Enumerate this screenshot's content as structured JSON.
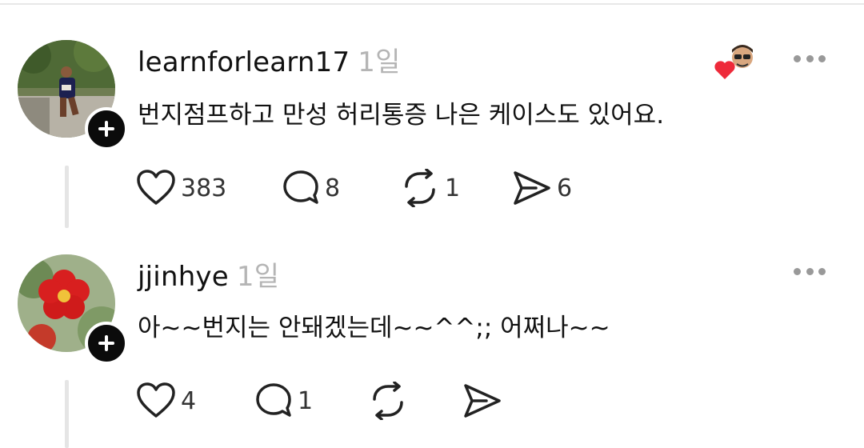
{
  "posts": [
    {
      "username": "learnforlearn17",
      "time": "1일",
      "text": "번지점프하고 만성 허리통증 나은 케이스도 있어요.",
      "counts": {
        "likes": "383",
        "replies": "8",
        "reposts": "1",
        "shares": "6"
      },
      "avatar_icon": "runner-photo"
    },
    {
      "username": "jjinhye",
      "time": "1일",
      "text": "아~~번지는 안돼겠는데~~^^;; 어쩌나~~",
      "counts": {
        "likes": "4",
        "replies": "1",
        "reposts": "",
        "shares": ""
      },
      "avatar_icon": "red-flower-photo"
    }
  ],
  "colors": {
    "accent_like": "#ee2a3a",
    "muted": "#b5b5b5"
  }
}
